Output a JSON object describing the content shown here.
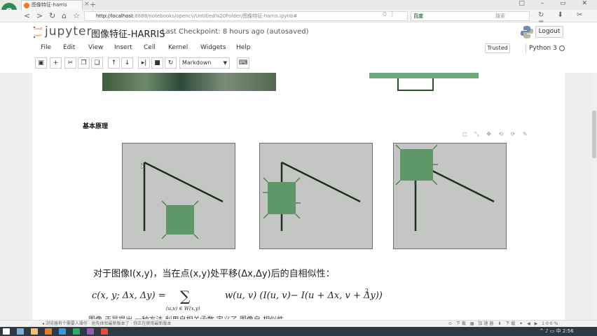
{
  "browser": {
    "app_logo": "e",
    "tab_title": "图像特征-harris",
    "url_host": "http://localhost",
    "url_rest": ":8888/notebooks/opencv/Untitled%20Folder/图像特征-harris.ipynb#",
    "search_brand": "百度",
    "search_placeholder": "搜索",
    "window_controls": "□ – ▭ ✕",
    "addr_icons": "↻ ⬇ ✂ ≡"
  },
  "jupyter": {
    "logo_text": "jupyter",
    "notebook_title": "图像特征-HARRIS",
    "checkpoint": "Last Checkpoint: 8 hours ago (autosaved)",
    "logout_label": "Logout",
    "trusted_label": "Trusted",
    "kernel_label": "Python 3"
  },
  "menu": [
    "File",
    "Edit",
    "View",
    "Insert",
    "Cell",
    "Kernel",
    "Widgets",
    "Help"
  ],
  "toolbar": {
    "buttons": [
      {
        "name": "save-button",
        "glyph": "▣"
      },
      {
        "name": "add-cell-button",
        "glyph": "+"
      },
      {
        "name": "cut-button",
        "glyph": "✂"
      },
      {
        "name": "copy-button",
        "glyph": "❐"
      },
      {
        "name": "paste-button",
        "glyph": "❏"
      },
      {
        "name": "move-up-button",
        "glyph": "↑"
      },
      {
        "name": "move-down-button",
        "glyph": "↓"
      },
      {
        "name": "run-button",
        "glyph": "▸|"
      },
      {
        "name": "stop-button",
        "glyph": "■"
      },
      {
        "name": "restart-button",
        "glyph": "↻"
      }
    ],
    "cell_type": "Markdown",
    "keyboard_glyph": "⌨"
  },
  "notebook": {
    "section_heading": "基本原理",
    "cell_tools": "◻ ⤡ ✥ ⟲ ⟳ ✎",
    "description": "对于图像I(x,y)，当在点(x,y)处平移(Δx,Δy)后的自相似性：",
    "formula": {
      "lhs": "c(x, y; Δx, Δy) =",
      "sum": "∑",
      "sub": "(u,v) ∈ W(x,y)",
      "rhs": "w(u, v) (I(u, v)− I(u + Δx, v + Δy))",
      "exp": "2"
    },
    "cut_text": "图像 于是提出 一种方法 利用自相关函数 定义了 图像自 相似性"
  },
  "status": {
    "left": "◂ 浏览器有个需要人操作  ·  抢先体验最新版本了  ·  你正在使用最新版本",
    "right": "⊙ 下载  ▦ 加速器  ⬇ 下载  ✦ ◀ ▶ 100%"
  },
  "taskbar": {
    "tray": "^ ♪ ▭ 中  2:56",
    "icon_colors": [
      "#ffffff",
      "#7fb3d5",
      "#f5c26b",
      "#e67e22",
      "#3498db",
      "#27ae60",
      "#9b59b6",
      "#e74c3c"
    ]
  },
  "colors": {
    "green_patch": "#5e9868",
    "panel_bg": "#c4c6c4",
    "jupyter_orange": "#f37726"
  }
}
